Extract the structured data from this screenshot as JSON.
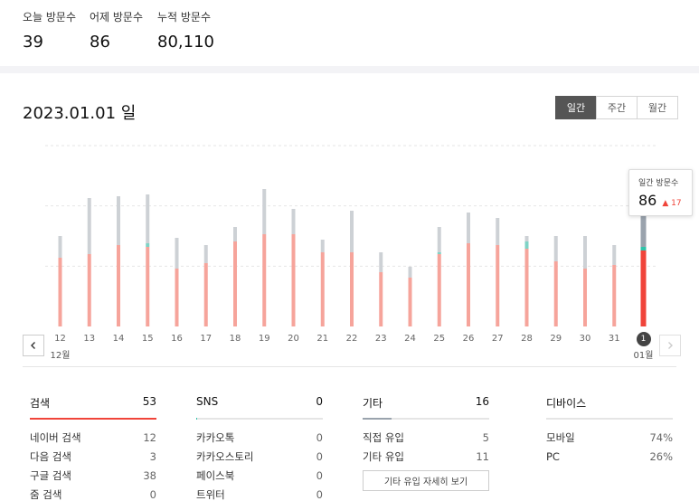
{
  "stats": [
    {
      "label": "오늘 방문수",
      "value": "39"
    },
    {
      "label": "어제 방문수",
      "value": "86"
    },
    {
      "label": "누적 방문수",
      "value": "80,110"
    }
  ],
  "header": {
    "date_title": "2023.01.01 일"
  },
  "period_tabs": [
    {
      "label": "일간",
      "active": true
    },
    {
      "label": "주간",
      "active": false
    },
    {
      "label": "월간",
      "active": false
    }
  ],
  "tooltip": {
    "label": "일간 방문수",
    "value": "86",
    "delta": "▲ 17"
  },
  "chart_data": {
    "type": "bar",
    "stacked": true,
    "categories": [
      "12",
      "13",
      "14",
      "15",
      "16",
      "17",
      "18",
      "19",
      "20",
      "21",
      "22",
      "23",
      "24",
      "25",
      "26",
      "27",
      "28",
      "29",
      "30",
      "31",
      "1"
    ],
    "month_labels": [
      {
        "index": 0,
        "label": "12월"
      },
      {
        "index": 20,
        "label": "01월"
      }
    ],
    "selected_index": 20,
    "ylim": [
      0,
      100
    ],
    "grid": true,
    "series": [
      {
        "values": [
          38,
          40,
          45,
          44,
          32,
          35,
          47,
          51,
          51,
          41,
          41,
          30,
          27,
          40,
          46,
          45,
          43,
          36,
          32,
          34,
          42
        ],
        "color": "#f6a49b",
        "selected_color": "#f0443a"
      },
      {
        "values": [
          0,
          0,
          0,
          2,
          0,
          0,
          0,
          0,
          0,
          0,
          0,
          0,
          0,
          1,
          0,
          0,
          4,
          0,
          0,
          0,
          2
        ],
        "color": "#7fd3c6",
        "selected_color": "#2ec4a9"
      },
      {
        "values": [
          12,
          31,
          27,
          27,
          17,
          10,
          8,
          25,
          14,
          7,
          23,
          11,
          6,
          14,
          17,
          15,
          3,
          14,
          18,
          11,
          23
        ],
        "color": "#cdd1d5",
        "selected_color": "#9aa3ad"
      }
    ]
  },
  "breakdown": [
    {
      "title": "검색",
      "total": "53",
      "fill": 1.0,
      "color": "#f0443a",
      "rows": [
        {
          "label": "네이버 검색",
          "value": "12"
        },
        {
          "label": "다음 검색",
          "value": "3"
        },
        {
          "label": "구글 검색",
          "value": "38"
        },
        {
          "label": "줌 검색",
          "value": "0"
        }
      ]
    },
    {
      "title": "SNS",
      "total": "0",
      "fill": 0.01,
      "color": "#2ec4a9",
      "rows": [
        {
          "label": "카카오톡",
          "value": "0"
        },
        {
          "label": "카카오스토리",
          "value": "0"
        },
        {
          "label": "페이스북",
          "value": "0"
        },
        {
          "label": "트위터",
          "value": "0"
        }
      ]
    },
    {
      "title": "기타",
      "total": "16",
      "fill": 0.23,
      "color": "#9aa3ad",
      "rows": [
        {
          "label": "직접 유입",
          "value": "5"
        },
        {
          "label": "기타 유입",
          "value": "11"
        }
      ],
      "button": "기타 유입 자세히 보기"
    },
    {
      "title": "디바이스",
      "total": "",
      "fill": 0,
      "color": "#999",
      "rows": [
        {
          "label": "모바일",
          "value": "74%"
        },
        {
          "label": "PC",
          "value": "26%"
        }
      ]
    }
  ],
  "icons": {
    "prev": "chevron-left-icon",
    "next": "chevron-right-icon"
  }
}
